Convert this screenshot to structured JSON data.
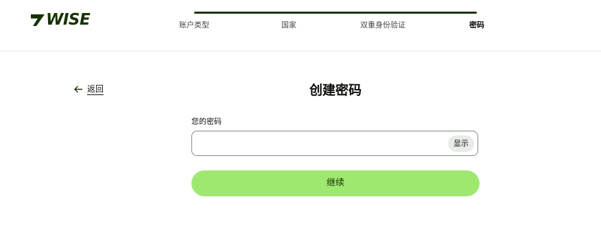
{
  "brand": {
    "name": "WISE",
    "colors": {
      "primary": "#163300",
      "accent": "#9fe870",
      "text": "#0e0f0c",
      "muted": "#454745"
    }
  },
  "stepper": {
    "progress": 1.0,
    "steps": [
      {
        "label": "账户类型"
      },
      {
        "label": "国家"
      },
      {
        "label": "双重身份验证"
      },
      {
        "label": "密码"
      }
    ],
    "active_index": 3
  },
  "back": {
    "icon": "arrow-left-icon",
    "label": "返回"
  },
  "main": {
    "title": "创建密码",
    "password_field": {
      "label": "您的密码",
      "value": "",
      "placeholder": "",
      "toggle_label": "显示"
    },
    "continue_label": "继续"
  }
}
